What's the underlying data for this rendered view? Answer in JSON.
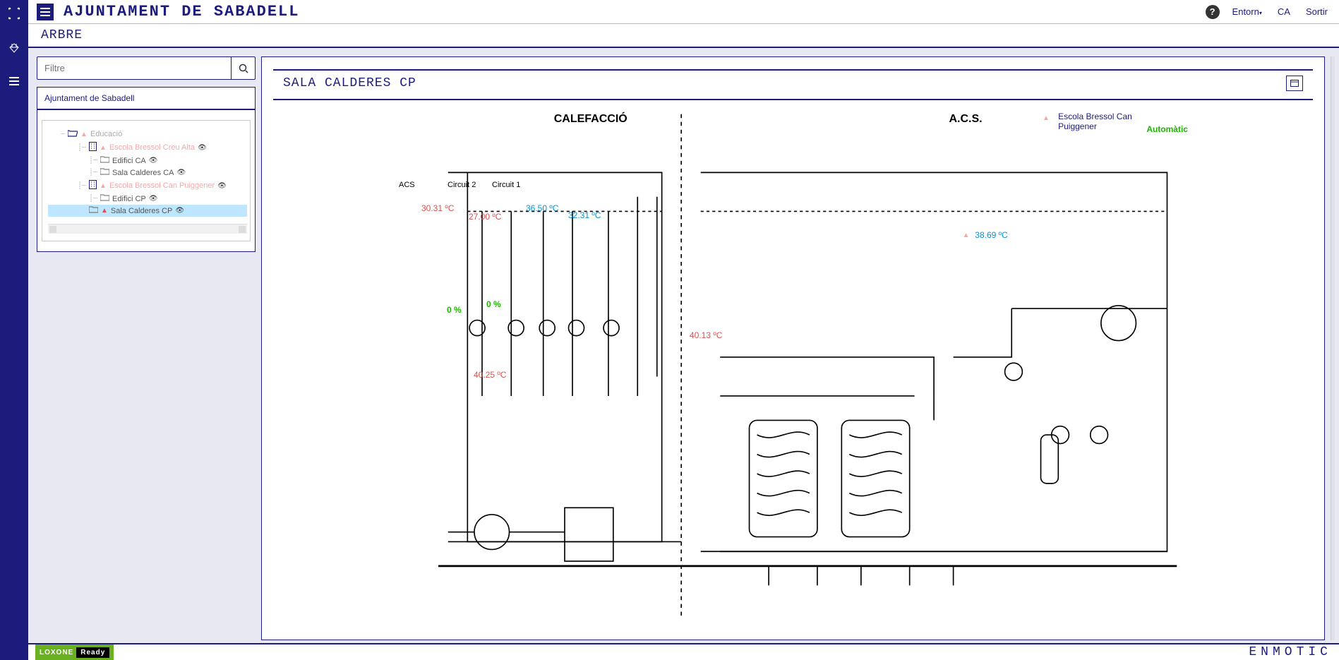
{
  "header": {
    "title": "AJUNTAMENT DE SABADELL",
    "subhead": "ARBRE",
    "help_tooltip": "?",
    "menu_entorn": "Entorn",
    "lang": "CA",
    "logout": "Sortir"
  },
  "search": {
    "placeholder": "Filtre"
  },
  "tree": {
    "root": "Ajuntament de Sabadell",
    "nodes": {
      "educacio": "Educació",
      "eba": "Escola Bressol Creu Alta",
      "edifici_ca": "Edifici CA",
      "sala_ca": "Sala Calderes CA",
      "ebp": "Escola Bressol Can Puiggener",
      "edifici_cp": "Edifici CP",
      "sala_cp": "Sala Calderes CP"
    }
  },
  "panel": {
    "title": "SALA CALDERES CP",
    "heading_left": "CALEFACCIÓ",
    "heading_right": "A.C.S.",
    "link_text": "Escola Bressol Can Puiggener",
    "mode": "Automàtic",
    "labels": {
      "acs": "ACS",
      "circuit2": "Circuit 2",
      "circuit1": "Circuit 1"
    },
    "readings": {
      "t1": "30.31 ºC",
      "t2": "27.00 ºC",
      "t3": "36.50 ºC",
      "t4": "32.31 ºC",
      "t5": "38.69 ºC",
      "t6": "40.13 ºC",
      "t7": "40.25 ºC",
      "p1": "0 %",
      "p2": "0 %"
    }
  },
  "footer": {
    "loxone": "LOXONE",
    "ready": "Ready",
    "brand": "ENMOTIC"
  }
}
